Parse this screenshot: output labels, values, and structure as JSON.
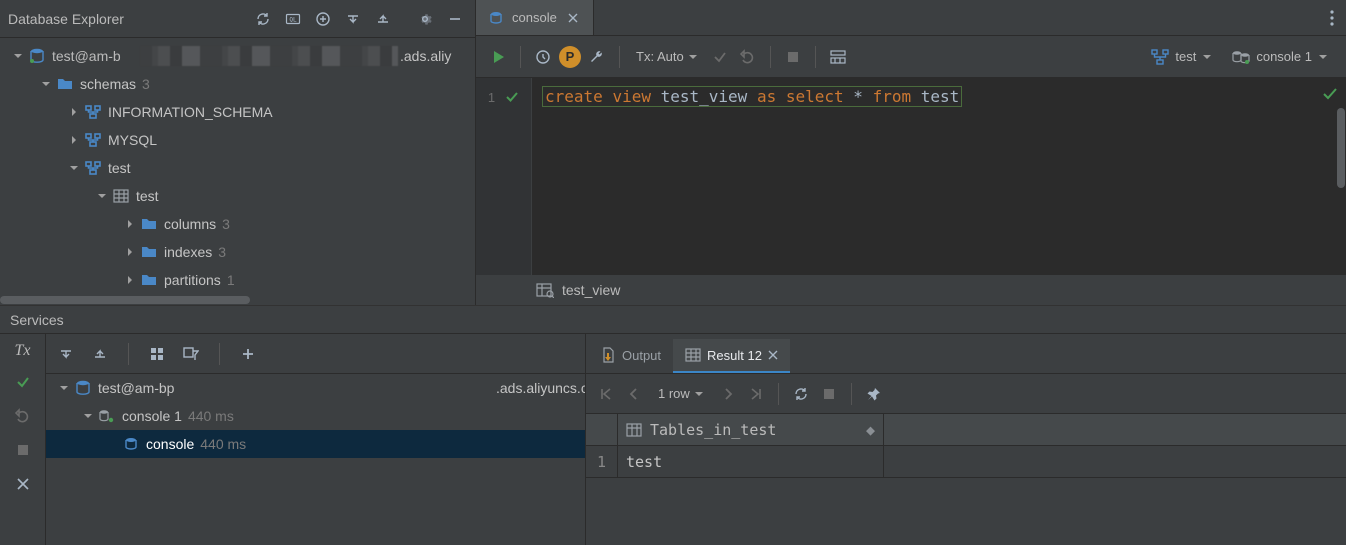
{
  "explorer": {
    "title": "Database Explorer",
    "root_label": "test@am-b",
    "root_suffix": ".ads.aliy",
    "schemas_label": "schemas",
    "schemas_count": "3",
    "schema_info": "INFORMATION_SCHEMA",
    "schema_mysql": "MYSQL",
    "schema_test": "test",
    "table_test": "test",
    "columns_label": "columns",
    "columns_count": "3",
    "indexes_label": "indexes",
    "indexes_count": "3",
    "partitions_label": "partitions",
    "partitions_count": "1"
  },
  "editor": {
    "tab_label": "console",
    "p_badge": "P",
    "tx_label": "Tx: Auto",
    "src_db": "test",
    "src_console": "console 1",
    "gutter_line": "1",
    "sql_kw1": "create",
    "sql_kw2": "view",
    "sql_id1": "test_view",
    "sql_kw3": "as",
    "sql_kw4": "select",
    "sql_star": "*",
    "sql_kw5": "from",
    "sql_id2": "test",
    "status_view": "test_view"
  },
  "services": {
    "title": "Services",
    "left_tx": "Tx",
    "conn_label": "test@am-bp",
    "conn_suffix": ".ads.aliyuncs.co",
    "console1_label": "console 1",
    "console1_ms": "440 ms",
    "console_leaf_label": "console",
    "console_leaf_ms": "440 ms",
    "tab_output": "Output",
    "tab_result": "Result 12",
    "rows_label": "1 row",
    "col_header": "Tables_in_test",
    "row1_num": "1",
    "row1_val": "test"
  }
}
